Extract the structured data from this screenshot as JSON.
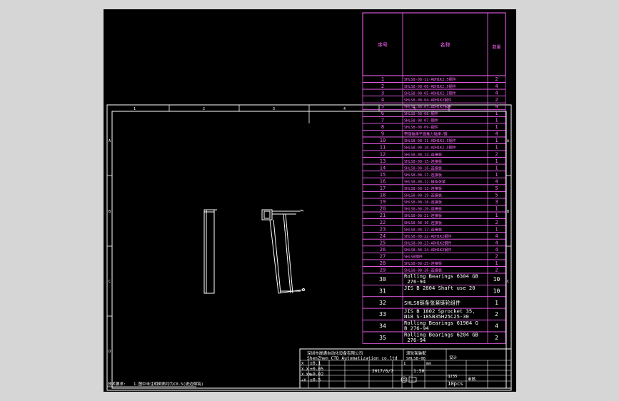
{
  "colors": {
    "background": "#000000",
    "frame": "#ffffff",
    "bom": "#ff66ff",
    "page": "#d6d6d6"
  },
  "frame": {
    "col_labels": [
      "1",
      "2",
      "3",
      "4",
      "5"
    ],
    "row_labels_left": [
      "A",
      "B",
      "C",
      "D"
    ],
    "row_labels_right": [
      "A",
      "B",
      "C"
    ]
  },
  "bom": {
    "header": {
      "no": "序号",
      "name": "名称",
      "qty": "数量"
    },
    "rows": [
      {
        "no": "1",
        "name": "SHLS8-08-11-ADH1K2.5钢件",
        "qty": "2"
      },
      {
        "no": "2",
        "name": "SHLS8-08-06-ADH1K2.5钢件",
        "qty": "4"
      },
      {
        "no": "3",
        "name": "SHLS8-08-05-ADH1K2.5钢件",
        "qty": "4"
      },
      {
        "no": "4",
        "name": "SHLS8-08-04-ADH1K2钢件",
        "qty": "2"
      },
      {
        "no": "5",
        "name": "SHLS8-08-03-ADH1K2钢件",
        "qty": "4"
      },
      {
        "no": "6",
        "name": "SHLS8-08-08-钢件",
        "qty": "1"
      },
      {
        "no": "7",
        "name": "SHLS8-08-07-钢件",
        "qty": "1"
      },
      {
        "no": "8",
        "name": "SHLS8-08-09-钢件",
        "qty": "1"
      },
      {
        "no": "9",
        "name": "带座轴承平面推力轴承-钢",
        "qty": "4"
      },
      {
        "no": "10",
        "name": "SHLS8-08-11-ADH1K2.5钢件",
        "qty": "1"
      },
      {
        "no": "11",
        "name": "SHLS8-08-10-ADH1K2.5钢件",
        "qty": "1"
      },
      {
        "no": "12",
        "name": "SHLS8-08-14-连接板",
        "qty": "2"
      },
      {
        "no": "13",
        "name": "SHLS8-08-15-连接板",
        "qty": "1"
      },
      {
        "no": "14",
        "name": "SHLS8-08-16-连接板",
        "qty": "1"
      },
      {
        "no": "15",
        "name": "SHLS8-08-17-连接板",
        "qty": "1"
      },
      {
        "no": "16",
        "name": "SHLS8-08-12-链条张紧",
        "qty": "4"
      },
      {
        "no": "17",
        "name": "SHLS8-08-13-连接板",
        "qty": "5"
      },
      {
        "no": "18",
        "name": "SHLS8-08-19-连接板",
        "qty": "5"
      },
      {
        "no": "19",
        "name": "SHLS8-08-18-连接板",
        "qty": "3"
      },
      {
        "no": "20",
        "name": "SHLS8-08-20-连接板",
        "qty": "1"
      },
      {
        "no": "21",
        "name": "SHLS8-08-21-连接板",
        "qty": "1"
      },
      {
        "no": "22",
        "name": "SHLS8-08-16-连接板",
        "qty": "2"
      },
      {
        "no": "23",
        "name": "SHLS8-08-17-连接板",
        "qty": "1"
      },
      {
        "no": "24",
        "name": "SHLS8-08-22-ADH1K2钢件",
        "qty": "4"
      },
      {
        "no": "25",
        "name": "SHLS8-08-23-ADH1K2钢件",
        "qty": "4"
      },
      {
        "no": "26",
        "name": "SHLS8-08-24-ADH1K2钢件",
        "qty": "4"
      },
      {
        "no": "27",
        "name": "SHLS8钢件",
        "qty": "2"
      },
      {
        "no": "28",
        "name": "SHLS8-08-25-连接板",
        "qty": "1"
      },
      {
        "no": "29",
        "name": "SHLS8-08-26-连接板",
        "qty": "2"
      },
      {
        "no": "30",
        "name": "Rolling Bearings 6304 GB 276-94",
        "qty": "10"
      },
      {
        "no": "31",
        "name": "JIS B 2804 Shaft use 20",
        "qty": "10"
      },
      {
        "no": "32",
        "name": "SHLS8链条张紧链轮组件",
        "qty": "1"
      },
      {
        "no": "33",
        "name": "JIS B 1802 Sprocket 35, N18 S-18SB35H25C25-30",
        "qty": "2"
      },
      {
        "no": "34",
        "name": "Rolling Bearings 61904 GB 276-94",
        "qty": "4"
      },
      {
        "no": "35",
        "name": "Rolling Bearings 6204 GB 276-94",
        "qty": "2"
      }
    ]
  },
  "title_block": {
    "company_cn": "深圳市晟通自动化设备有限公司",
    "company_en": "ShenZhen CTD Automatization co.ltd",
    "drawing_name": "滚轮架装配",
    "drawing_no": "SHLS8-08",
    "tol_rows": [
      {
        "label": "X",
        "value": "±0.1"
      },
      {
        "label": "X.X",
        "value": "±0.05"
      },
      {
        "label": "X.XX",
        "value": "±0.02"
      },
      {
        "label": "∠X",
        "value": "±0.5"
      }
    ],
    "date": "2017/6/7",
    "scale": "1:50",
    "sheet": "1",
    "unit": "mm",
    "material": "Q235",
    "quantity": "10pcs",
    "designer_label": "设计",
    "checker_label": "审核"
  },
  "notes": {
    "left": "技术要求:",
    "text": "1.图中未注明倒角均为C0.5(锐边倒钝)"
  }
}
